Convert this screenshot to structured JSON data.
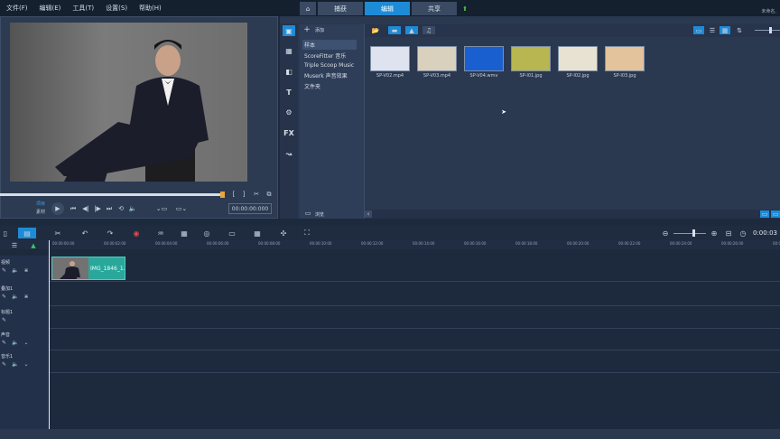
{
  "menubar": {
    "items": [
      "文件(F)",
      "编辑(E)",
      "工具(T)",
      "设置(S)",
      "帮助(H)"
    ]
  },
  "tabs": {
    "home_icon": "home-icon",
    "items": [
      "捕获",
      "编辑",
      "共享"
    ],
    "active": "编辑",
    "upload_icon": "upload-arrow-icon"
  },
  "user_label": "未命名,",
  "player": {
    "mode_labels": [
      "项目",
      "素材"
    ],
    "timecode": "00:00:00:000",
    "scrub_position": 0.81
  },
  "library": {
    "add_label": "添加",
    "browse_label": "浏览",
    "folders": [
      "样本",
      "ScoreFitter 音乐",
      "Triple Scoop Music",
      "Muserk 声音效果",
      "文件夹"
    ],
    "active_folder": "样本",
    "side_icons": [
      "media-icon",
      "instant-project-icon",
      "transition-icon",
      "title-icon",
      "graphic-icon",
      "FX",
      "path-icon"
    ],
    "thumbnails": [
      {
        "label": "SP-V02.mp4",
        "color": "#dfe3ef"
      },
      {
        "label": "SP-V03.mp4",
        "color": "#d9d0bd"
      },
      {
        "label": "SP-V04.wmv",
        "color": "#1a5fd0"
      },
      {
        "label": "SP-I01.jpg",
        "color": "#b7b650"
      },
      {
        "label": "SP-I02.jpg",
        "color": "#e7e2d2"
      },
      {
        "label": "SP-I03.jpg",
        "color": "#e2c39c"
      }
    ]
  },
  "timeline": {
    "ruler": [
      "00:00:00:00",
      "00:00:02:00",
      "00:00:04:00",
      "00:00:06:00",
      "00:00:08:00",
      "00:00:10:00",
      "00:00:12:00",
      "00:00:14:00",
      "00:00:16:00",
      "00:00:18:00",
      "00:00:20:00",
      "00:00:22:00",
      "00:00:24:00",
      "00:00:26:00",
      "00:00:28:00"
    ],
    "timecode": "0:00:03",
    "tracks": [
      "视频",
      "叠加1",
      "标题1",
      "声音",
      "音乐1"
    ],
    "clip_label": "IMG_1846_1."
  }
}
